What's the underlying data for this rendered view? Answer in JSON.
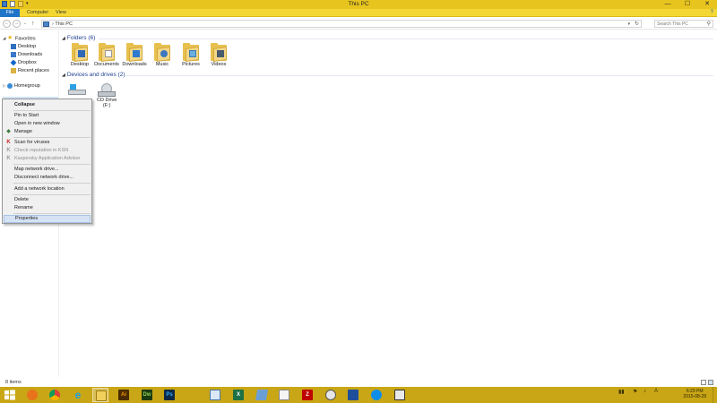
{
  "window": {
    "title": "This PC",
    "controls": {
      "minimize": "—",
      "maximize": "☐",
      "close": "✕"
    }
  },
  "ribbon": {
    "tabs": [
      "File",
      "Computer",
      "View"
    ],
    "help": "?"
  },
  "address": {
    "back": "←",
    "forward": "→",
    "recent": "⌄",
    "up": "↑",
    "breadcrumb": "This PC",
    "dropdown": "▾",
    "refresh": "↻",
    "search_placeholder": "Search This PC"
  },
  "nav_pane": {
    "favorites": {
      "label": "Favorites",
      "items": [
        "Desktop",
        "Downloads",
        "Dropbox",
        "Recent places"
      ]
    },
    "homegroup": "Homegroup"
  },
  "content": {
    "folders_header": "Folders (6)",
    "folders": [
      {
        "label": "Desktop",
        "icon": "desktop-folder-icon"
      },
      {
        "label": "Documents",
        "icon": "documents-folder-icon"
      },
      {
        "label": "Downloads",
        "icon": "downloads-folder-icon"
      },
      {
        "label": "Music",
        "icon": "music-folder-icon"
      },
      {
        "label": "Pictures",
        "icon": "pictures-folder-icon"
      },
      {
        "label": "Videos",
        "icon": "videos-folder-icon"
      }
    ],
    "devices_header": "Devices and drives (2)",
    "cd_drive": {
      "label": "CD Drive",
      "letter": "(F:)"
    }
  },
  "context_menu": {
    "items": [
      {
        "label": "Collapse",
        "bold": true
      },
      {
        "label": "Pin to Start"
      },
      {
        "label": "Open in new window"
      },
      {
        "label": "Manage",
        "icon": "manage-shield-icon"
      },
      {
        "label": "Scan for viruses",
        "icon": "kaspersky-icon"
      },
      {
        "label": "Check reputation in KSN",
        "disabled": true,
        "icon": "ksn-icon"
      },
      {
        "label": "Kaspersky Application Advisor",
        "disabled": true,
        "icon": "advisor-icon"
      },
      {
        "label": "Map network drive..."
      },
      {
        "label": "Disconnect network drive..."
      },
      {
        "label": "Add a network location"
      },
      {
        "label": "Delete"
      },
      {
        "label": "Rename"
      },
      {
        "label": "Properties",
        "highlighted": true
      }
    ]
  },
  "status_bar": {
    "count": "8 items"
  },
  "taskbar": {
    "apps": [
      "firefox-icon",
      "chrome-icon",
      "internet-explorer-icon",
      "file-explorer-icon",
      "illustrator-icon",
      "dreamweaver-icon",
      "photoshop-icon",
      "photo-viewer-icon",
      "excel-icon",
      "app-icon",
      "document-icon",
      "filezilla-icon",
      "steam-icon",
      "remote-desktop-icon",
      "teamviewer-icon",
      "virtualbox-icon"
    ],
    "glyphs": {
      "ai": "Ai",
      "dw": "Dw",
      "ps": "Ps",
      "xl": "X",
      "fz": "Z"
    },
    "tray": {
      "network": "▮▮",
      "flag": "⚑",
      "volume": "♪",
      "lang": "A"
    },
    "time": "6:29 PM",
    "date": "2015-08-28"
  },
  "colors": {
    "accent": "#e8c51e",
    "taskbar": "#c9a616",
    "file_tab": "#1e74c8",
    "header_text": "#1e3f92",
    "menu_highlight": "#d5e3f4"
  }
}
